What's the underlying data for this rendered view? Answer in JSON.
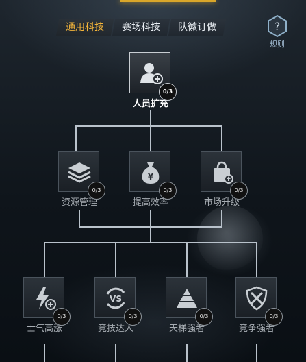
{
  "tabs": [
    {
      "label": "通用科技",
      "active": true
    },
    {
      "label": "赛场科技",
      "active": false
    },
    {
      "label": "队徽订做",
      "active": false
    }
  ],
  "rules": {
    "label": "规则",
    "icon": "question-hex-icon"
  },
  "tree": {
    "root": {
      "label": "人员扩充",
      "progress": "0/3",
      "icon": "person-add-icon"
    },
    "tier1": [
      {
        "label": "资源管理",
        "progress": "0/3",
        "icon": "stacked-layers-icon"
      },
      {
        "label": "提高效率",
        "progress": "0/3",
        "icon": "money-bag-icon"
      },
      {
        "label": "市场升级",
        "progress": "0/3",
        "icon": "shopping-bag-upgrade-icon"
      }
    ],
    "tier2": [
      {
        "label": "士气高涨",
        "progress": "0/3",
        "icon": "lightning-plus-icon"
      },
      {
        "label": "竞技达人",
        "progress": "0/3",
        "icon": "versus-icon"
      },
      {
        "label": "天梯强者",
        "progress": "0/3",
        "icon": "pyramid-icon"
      },
      {
        "label": "竞争强者",
        "progress": "0/3",
        "icon": "crossed-shield-icon"
      }
    ]
  },
  "colors": {
    "accent": "#f3b43a",
    "line": "#b9c2cb"
  }
}
